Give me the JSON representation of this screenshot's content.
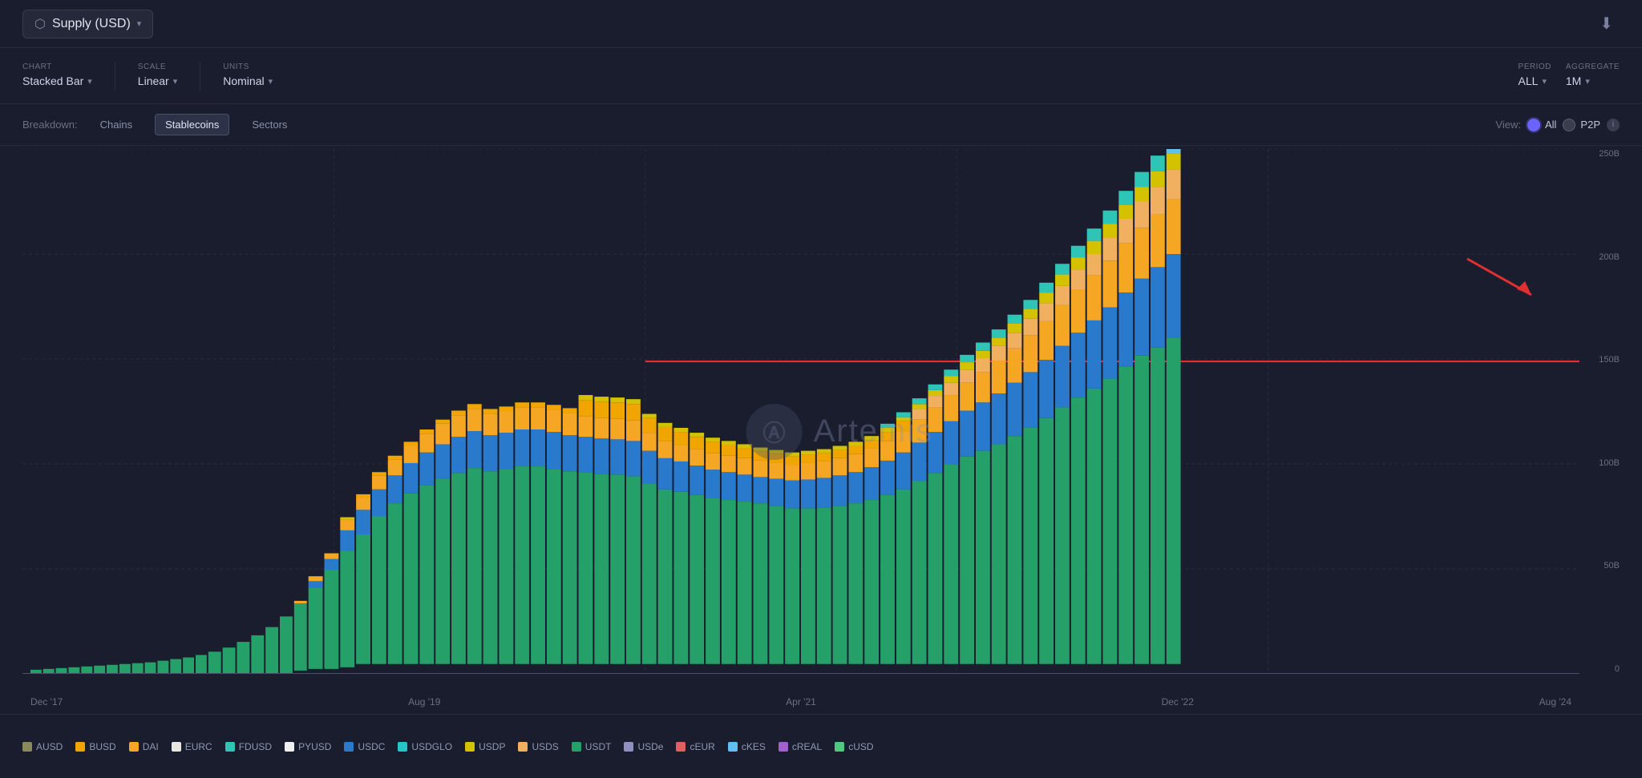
{
  "header": {
    "title": "Supply (USD)",
    "title_icon": "📈",
    "download_icon": "⬇"
  },
  "controls": {
    "chart_label": "CHART",
    "chart_value": "Stacked Bar",
    "scale_label": "SCALE",
    "scale_value": "Linear",
    "units_label": "UNITS",
    "units_value": "Nominal",
    "period_label": "PERIOD",
    "period_value": "ALL",
    "aggregate_label": "AGGREGATE",
    "aggregate_value": "1M"
  },
  "breakdown": {
    "label": "Breakdown:",
    "options": [
      "Chains",
      "Stablecoins",
      "Sectors"
    ],
    "active": "Stablecoins"
  },
  "view": {
    "label": "View:",
    "options": [
      "All",
      "P2P"
    ],
    "active": "All"
  },
  "chart": {
    "y_labels": [
      "250B",
      "200B",
      "150B",
      "100B",
      "50B",
      "0"
    ],
    "x_labels": [
      "Dec '17",
      "Aug '19",
      "Apr '21",
      "Dec '22",
      "Aug '24"
    ]
  },
  "legend": [
    {
      "id": "AUSD",
      "color": "#8a8a5c"
    },
    {
      "id": "BUSD",
      "color": "#f0a500"
    },
    {
      "id": "DAI",
      "color": "#f5a623"
    },
    {
      "id": "EURC",
      "color": "#e8e8e0"
    },
    {
      "id": "FDUSD",
      "color": "#2ec4b6"
    },
    {
      "id": "PYUSD",
      "color": "#f0f0f0"
    },
    {
      "id": "USDC",
      "color": "#2979cc"
    },
    {
      "id": "USDGLO",
      "color": "#26c6c6"
    },
    {
      "id": "USDP",
      "color": "#d4c200"
    },
    {
      "id": "USDS",
      "color": "#f0b060"
    },
    {
      "id": "USDT",
      "color": "#26a069"
    },
    {
      "id": "USDe",
      "color": "#9090c0"
    },
    {
      "id": "cEUR",
      "color": "#e06060"
    },
    {
      "id": "cKES",
      "color": "#60c0f0"
    },
    {
      "id": "cREAL",
      "color": "#a060d0"
    },
    {
      "id": "cUSD",
      "color": "#50c880"
    }
  ],
  "watermark": {
    "letter": "⬡",
    "text": "Artemis"
  }
}
